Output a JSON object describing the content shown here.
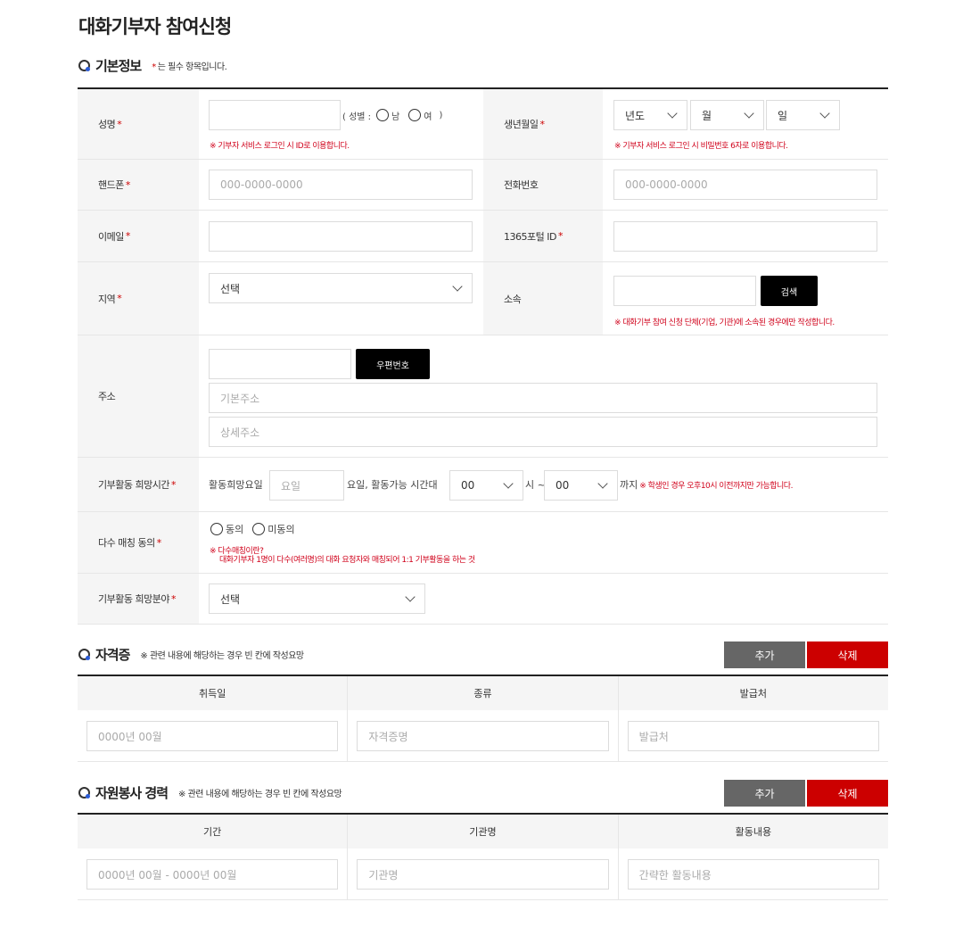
{
  "page_title": "대화기부자 참여신청",
  "basic": {
    "title": "기본정보",
    "note_star": "*",
    "note": "는 필수 항목입니다.",
    "name": {
      "label": "성명",
      "gender_open": "( 성별 :",
      "male": "남",
      "female": "여",
      "gender_close": ")",
      "hint": "※ 기부자 서비스 로그인 시 ID로 이용합니다."
    },
    "birth": {
      "label": "생년월일",
      "year": "년도",
      "month": "월",
      "day": "일",
      "hint": "※ 기부자 서비스 로그인 시 비밀번호 6자로 이용합니다."
    },
    "mobile": {
      "label": "핸드폰 ",
      "placeholder": "000-0000-0000"
    },
    "phone": {
      "label": "전화번호",
      "placeholder": "000-0000-0000"
    },
    "email": {
      "label": "이메일 "
    },
    "portal": {
      "label": "1365포털 ID"
    },
    "region": {
      "label": "지역",
      "selected": "선택"
    },
    "affil": {
      "label": "소속",
      "search_btn": "검색",
      "hint": "※ 대화기부 참여 신청 단체(기업, 기관)에 소속된 경우에만 작성합니다."
    },
    "address": {
      "label": "주소",
      "zip_btn": "우편번호",
      "basic_placeholder": "기본주소",
      "detail_placeholder": "상세주소"
    },
    "time": {
      "label": "기부활동 희망시간",
      "day_label": "활동희망요일",
      "day_placeholder": "요일",
      "avail_label": "요일,  활동가능 시간대",
      "hour": "00",
      "sep": "시 ~",
      "hour2": "00",
      "until": "까지",
      "hint": "※ 학생인 경우 오후10시 이전까지만 가능합니다."
    },
    "multi": {
      "label": "다수 매칭 동의",
      "agree": "동의",
      "disagree": "미동의",
      "hint1": "※ 다수매칭이란?",
      "hint2": "대화기부자 1명이 다수(여러명)의 대화 요청자와 매칭되어 1:1 기부활동을 하는 것"
    },
    "field": {
      "label": "기부활동 희망분야",
      "selected": "선택"
    },
    "star": "*"
  },
  "cert": {
    "title": "자격증",
    "note": "※ 관련 내용에 해당하는 경우 빈 칸에 작성요망",
    "add": "추가",
    "delete": "삭제",
    "headers": [
      "취득일",
      "종류",
      "발급처"
    ],
    "placeholders": [
      "0000년 00월",
      "자격증명",
      "발급처"
    ]
  },
  "volunteer": {
    "title": "자원봉사 경력",
    "note": "※ 관련 내용에 해당하는 경우 빈 칸에 작성요망",
    "add": "추가",
    "delete": "삭제",
    "headers": [
      "기간",
      "기관명",
      "활동내용"
    ],
    "placeholders": [
      "0000년 00월 - 0000년 00월",
      "기관명",
      "간략한 활동내용"
    ]
  }
}
